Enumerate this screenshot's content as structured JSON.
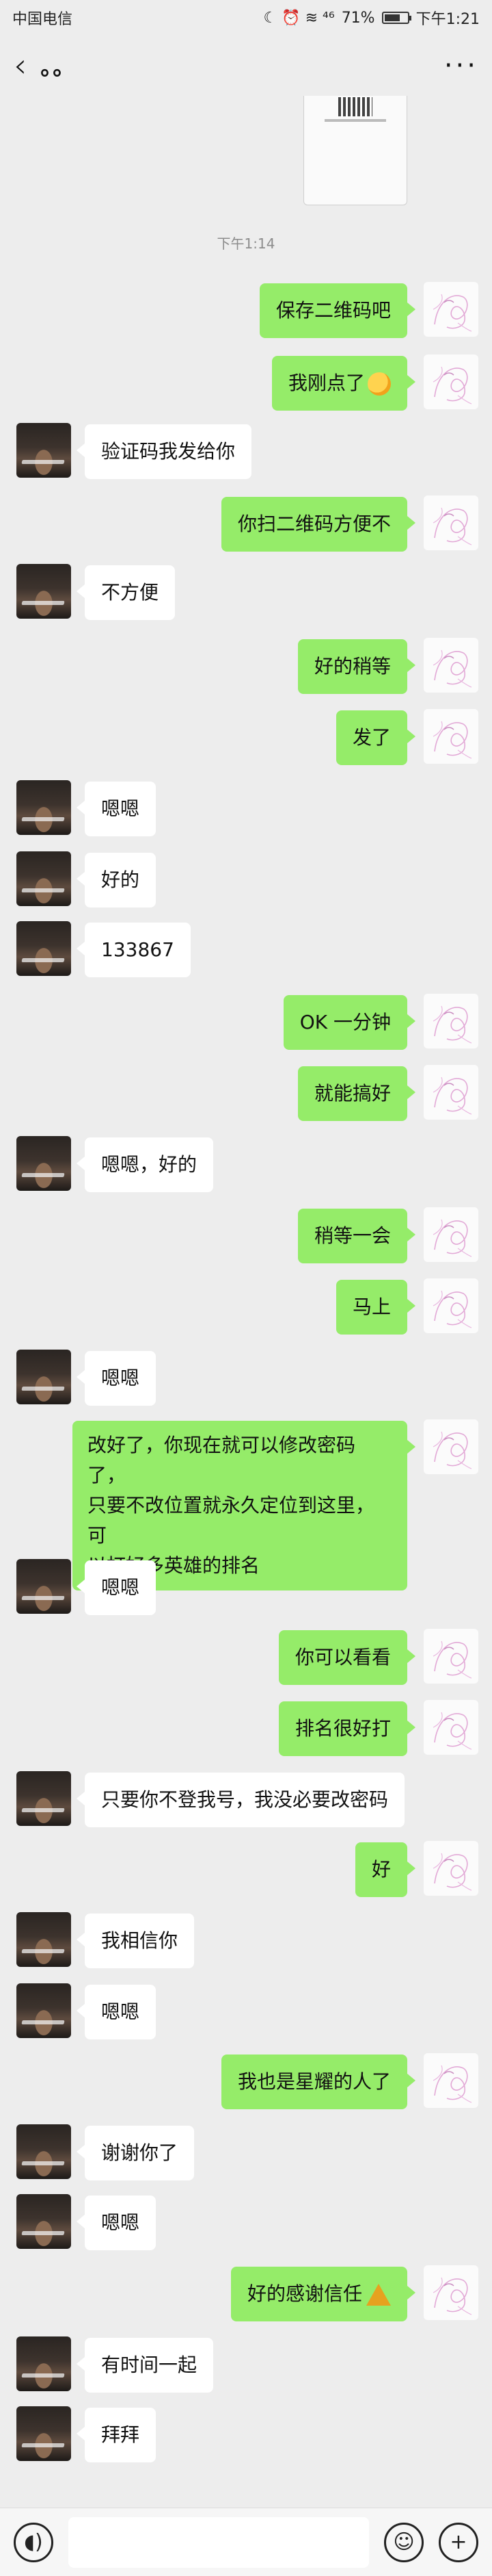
{
  "status_bar": {
    "carrier": "中国电信",
    "indicators": "☾ ⏰ ≋ ⁴⁶",
    "battery": "71%",
    "battery_level": 0.71,
    "time": "下午1:21"
  },
  "header": {
    "title": "。。",
    "back_icon": "chevron-left-icon",
    "more_icon": "more-horizontal-icon"
  },
  "timestamp": "下午1:14",
  "messages": [
    {
      "from": "self",
      "text": "保存二维码吧"
    },
    {
      "from": "self",
      "text": "我刚点了",
      "emoji": "grinning-sweat-emoji"
    },
    {
      "from": "other",
      "text": "验证码我发给你"
    },
    {
      "from": "self",
      "text": "你扫二维码方便不"
    },
    {
      "from": "other",
      "text": "不方便"
    },
    {
      "from": "self",
      "text": "好的稍等"
    },
    {
      "from": "self",
      "text": "发了"
    },
    {
      "from": "other",
      "text": "嗯嗯"
    },
    {
      "from": "other",
      "text": "好的"
    },
    {
      "from": "other",
      "text": "133867"
    },
    {
      "from": "self",
      "text": "OK 一分钟"
    },
    {
      "from": "self",
      "text": "就能搞好"
    },
    {
      "from": "other",
      "text": "嗯嗯，好的"
    },
    {
      "from": "self",
      "text": "稍等一会"
    },
    {
      "from": "self",
      "text": "马上"
    },
    {
      "from": "other",
      "text": "嗯嗯"
    },
    {
      "from": "self",
      "lines": [
        "改好了，你现在就可以修改密码了，",
        "只要不改位置就永久定位到这里，可",
        "以打好多英雄的排名"
      ]
    },
    {
      "from": "other",
      "text": "嗯嗯"
    },
    {
      "from": "self",
      "text": "你可以看看"
    },
    {
      "from": "self",
      "text": "排名很好打"
    },
    {
      "from": "other",
      "text": "只要你不登我号，我没必要改密码"
    },
    {
      "from": "self",
      "text": "好"
    },
    {
      "from": "other",
      "text": "我相信你"
    },
    {
      "from": "other",
      "text": "嗯嗯"
    },
    {
      "from": "self",
      "text": "我也是星耀的人了"
    },
    {
      "from": "other",
      "text": "谢谢你了"
    },
    {
      "from": "other",
      "text": "嗯嗯"
    },
    {
      "from": "self",
      "text": "好的感谢信任",
      "emoji": "tent-emoji"
    },
    {
      "from": "other",
      "text": "有时间一起"
    },
    {
      "from": "other",
      "text": "拜拜"
    }
  ],
  "input_bar": {
    "voice_icon": "voice-icon",
    "emoji_icon": "emoji-smile-icon",
    "plus_icon": "plus-icon",
    "placeholder": ""
  },
  "colors": {
    "background": "#ededed",
    "self_bubble": "#95ec69",
    "other_bubble": "#ffffff"
  }
}
